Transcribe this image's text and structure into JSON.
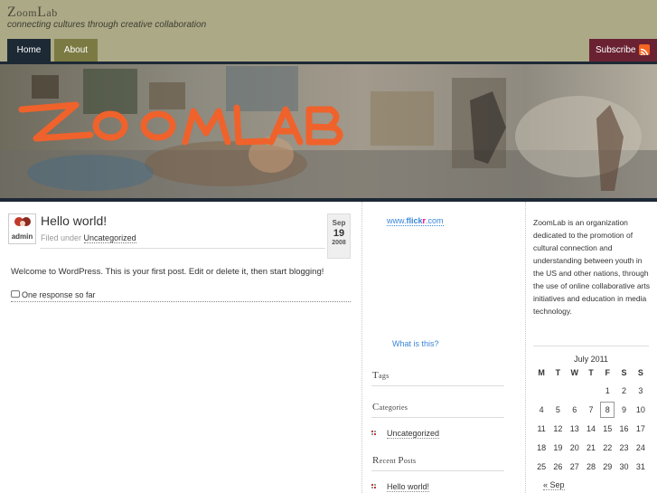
{
  "site": {
    "title_first": "Z",
    "title_rest": "oom",
    "title_second": "L",
    "title_second_rest": "ab",
    "tagline": "connecting cultures through creative collaboration"
  },
  "nav": {
    "items": [
      {
        "label": "Home",
        "active": true
      },
      {
        "label": "About",
        "active": false
      }
    ],
    "subscribe_label": "Subscribe",
    "subscribe_icon": "rss-icon"
  },
  "banner": {
    "logo_text": "ZOOMLAB",
    "colors": {
      "logo": "#f0622b",
      "strip": "#1d2935"
    }
  },
  "post": {
    "avatar_name": "admin",
    "title": "Hello world!",
    "filed_prefix": "Filed under",
    "category": "Uncategorized",
    "date": {
      "month": "Sep",
      "day": "19",
      "year": "2008"
    },
    "body": "Welcome to WordPress. This is your first post. Edit or delete it, then start blogging!",
    "comments_label": "One response so far"
  },
  "sidebar_middle": {
    "flickr_prefix": "www.",
    "flickr_brand_blue": "flick",
    "flickr_brand_pink": "r",
    "flickr_suffix": ".com",
    "whatis": "What is this?",
    "tags_first": "T",
    "tags_rest": "ags",
    "categories_first": "C",
    "categories_rest": "ategories",
    "categories": [
      "Uncategorized"
    ],
    "recent_first": "R",
    "recent_mid": "ecent ",
    "recent_p": "P",
    "recent_rest": "osts",
    "recent_posts": [
      "Hello world!"
    ]
  },
  "sidebar_right": {
    "about": "ZoomLab is an organization dedicated to the promotion of cultural connection and understanding between youth in the US and other nations, through the use of online collaborative arts initiatives and education in media technology.",
    "calendar": {
      "caption": "July 2011",
      "days": [
        "M",
        "T",
        "W",
        "T",
        "F",
        "S",
        "S"
      ],
      "weeks": [
        [
          "",
          "",
          "",
          "",
          "1",
          "2",
          "3"
        ],
        [
          "4",
          "5",
          "6",
          "7",
          "8",
          "9",
          "10"
        ],
        [
          "11",
          "12",
          "13",
          "14",
          "15",
          "16",
          "17"
        ],
        [
          "18",
          "19",
          "20",
          "21",
          "22",
          "23",
          "24"
        ],
        [
          "25",
          "26",
          "27",
          "28",
          "29",
          "30",
          "31"
        ]
      ],
      "today": "8",
      "prev_label": "« Sep"
    }
  }
}
